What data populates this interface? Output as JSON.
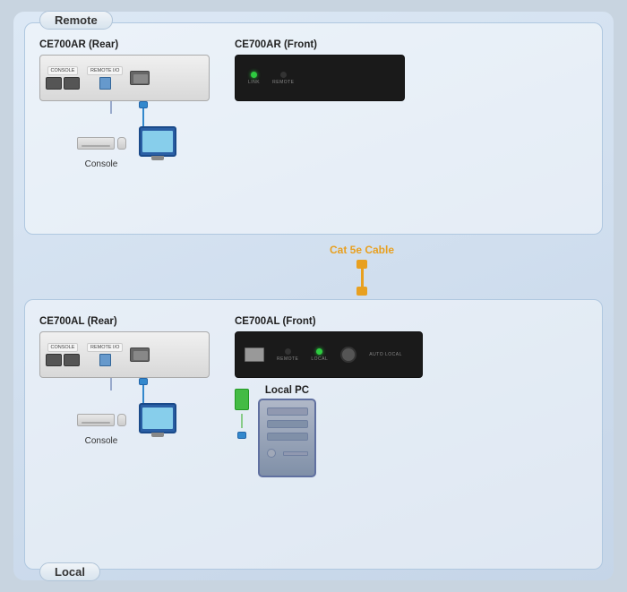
{
  "remote_label": "Remote",
  "local_label": "Local",
  "remote": {
    "rear_device_label": "CE700AR (Rear)",
    "front_device_label": "CE700AR (Front)",
    "console_label": "Console",
    "led1": "LINK",
    "led2": "REMOTE",
    "ports": {
      "console": "CONSOLE",
      "remote_io": "REMOTE I/O"
    }
  },
  "cable": {
    "label": "Cat 5e Cable"
  },
  "local": {
    "rear_device_label": "CE700AL (Rear)",
    "front_device_label": "CE700AL (Front)",
    "console_label": "Console",
    "pc_label": "Local PC",
    "led1": "REMOTE",
    "led2": "LOCAL",
    "led3": "AUTO LOCAL",
    "ports": {
      "console": "CONSOLE",
      "remote_io": "REMOTE I/O"
    }
  }
}
